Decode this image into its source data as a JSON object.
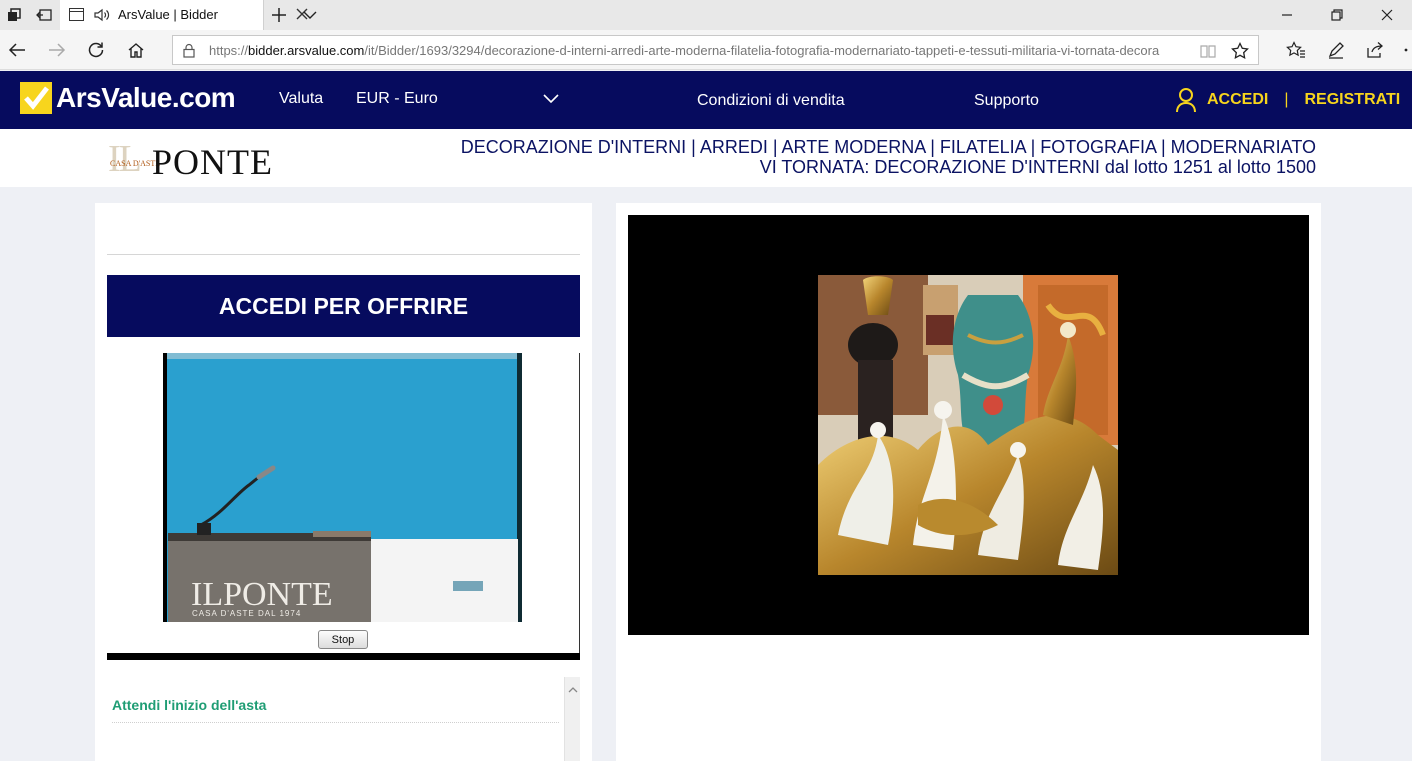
{
  "browser": {
    "tab_title": "ArsValue | Bidder",
    "url_prefix": "https://",
    "url_host": "bidder.arsvalue.com",
    "url_path": "/it/Bidder/1693/3294/decorazione-d-interni-arredi-arte-moderna-filatelia-fotografia-modernariato-tappeti-e-tessuti-militaria-vi-tornata-decora"
  },
  "header": {
    "logo_text": "ArsValue.com",
    "valuta_label": "Valuta",
    "currency_value": "EUR - Euro",
    "conditions_label": "Condizioni di vendita",
    "support_label": "Supporto",
    "login_label": "ACCEDI",
    "separator": "|",
    "register_label": "REGISTRATI"
  },
  "auction": {
    "house_logo": {
      "il": "IL",
      "casa": "CASA D'ASTE",
      "ponte": "PONTE"
    },
    "title_line1": "DECORAZIONE D'INTERNI | ARREDI | ARTE MODERNA | FILATELIA | FOTOGRAFIA | MODERNARIATO",
    "title_line2": "VI TORNATA: DECORAZIONE D'INTERNI dal lotto 1251 al lotto 1500"
  },
  "left_panel": {
    "bid_button_label": "ACCEDI PER OFFRIRE",
    "video": {
      "podium_brand": "ILPONTE",
      "podium_tagline": "CASA D'ASTE DAL 1974",
      "stop_label": "Stop"
    },
    "status_text": "Attendi l'inizio dell'asta"
  },
  "colors": {
    "brand_navy": "#060b5e",
    "brand_yellow": "#f7d51d",
    "status_green": "#1f9d74",
    "video_blue": "#2aa0cf"
  },
  "icons": {
    "chrome": [
      "tab-manager-icon",
      "set-aside-tabs-icon",
      "page-icon",
      "speaker-icon",
      "close-icon",
      "new-tab-icon",
      "tab-list-chevron-icon",
      "minimize-icon",
      "restore-icon",
      "window-close-icon"
    ],
    "nav": [
      "back-icon",
      "forward-icon",
      "refresh-icon",
      "home-icon",
      "lock-icon",
      "reading-view-icon",
      "favorite-star-icon",
      "favorites-icon",
      "pen-icon",
      "share-icon"
    ],
    "site": [
      "checkmark-logo-icon",
      "chevron-down-icon",
      "user-icon",
      "scroll-up-icon"
    ]
  }
}
